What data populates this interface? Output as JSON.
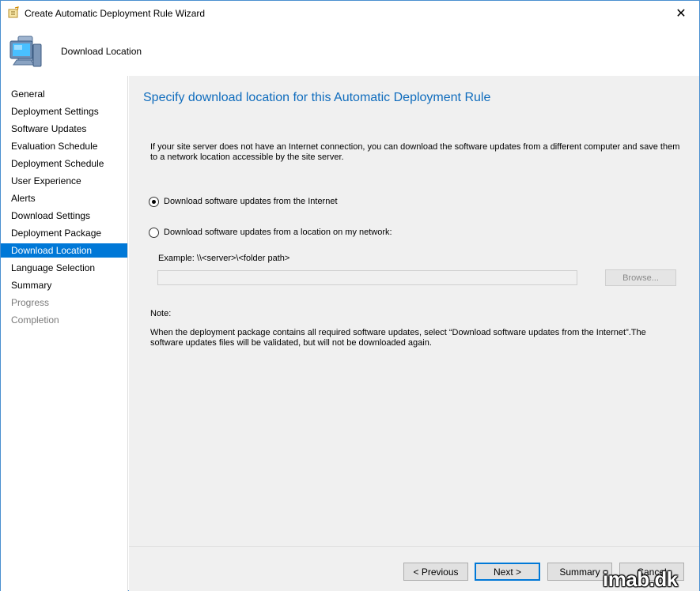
{
  "window": {
    "title": "Create Automatic Deployment Rule Wizard",
    "close_glyph": "✕"
  },
  "header": {
    "title": "Download Location"
  },
  "sidebar": {
    "items": [
      {
        "label": "General",
        "state": "normal"
      },
      {
        "label": "Deployment Settings",
        "state": "normal"
      },
      {
        "label": "Software Updates",
        "state": "normal"
      },
      {
        "label": "Evaluation Schedule",
        "state": "normal"
      },
      {
        "label": "Deployment Schedule",
        "state": "normal"
      },
      {
        "label": "User Experience",
        "state": "normal"
      },
      {
        "label": "Alerts",
        "state": "normal"
      },
      {
        "label": "Download Settings",
        "state": "normal"
      },
      {
        "label": "Deployment Package",
        "state": "normal"
      },
      {
        "label": "Download Location",
        "state": "active"
      },
      {
        "label": "Language Selection",
        "state": "normal"
      },
      {
        "label": "Summary",
        "state": "normal"
      },
      {
        "label": "Progress",
        "state": "disabled"
      },
      {
        "label": "Completion",
        "state": "disabled"
      }
    ]
  },
  "main": {
    "page_title": "Specify download location for this Automatic Deployment Rule",
    "intro": "If your site server does not have an Internet connection, you can download the software updates from a different computer and save them to a network location accessible by the site server.",
    "option_internet": {
      "label": "Download software updates from the Internet",
      "checked": true
    },
    "option_network": {
      "label": "Download software updates from a location on my network:",
      "checked": false
    },
    "example": "Example: \\\\<server>\\<folder path>",
    "path_value": "",
    "browse_label": "Browse...",
    "note_label": "Note:",
    "note_text": "When the deployment package contains all required software updates, select “Download  software updates from the Internet”.The software updates files will be validated, but will not be downloaded again."
  },
  "footer": {
    "previous_label": "< Previous",
    "next_label": "Next >",
    "summary_label": "Summary",
    "cancel_label": "Cancel"
  },
  "watermark": "imab.dk",
  "colors": {
    "accent": "#0078d7",
    "title_blue": "#0f6cbd",
    "content_bg": "#f0f0f0"
  }
}
